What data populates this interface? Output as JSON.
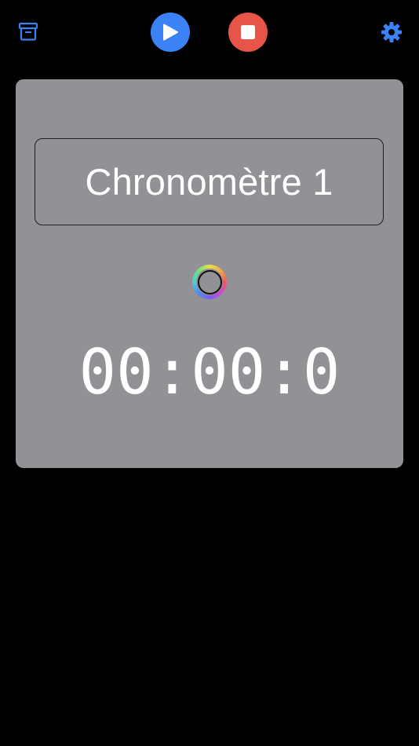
{
  "toolbar": {
    "archive_icon": "archive-box-icon",
    "play_icon": "play-icon",
    "stop_icon": "stop-icon",
    "settings_icon": "gear-icon",
    "colors": {
      "accent": "#3b82f6",
      "play_bg": "#3b82f6",
      "stop_bg": "#e65548"
    }
  },
  "card": {
    "name": "Chronomètre 1",
    "time": "00:00:0",
    "background": "#929196",
    "color_picker_icon": "color-wheel-icon"
  }
}
